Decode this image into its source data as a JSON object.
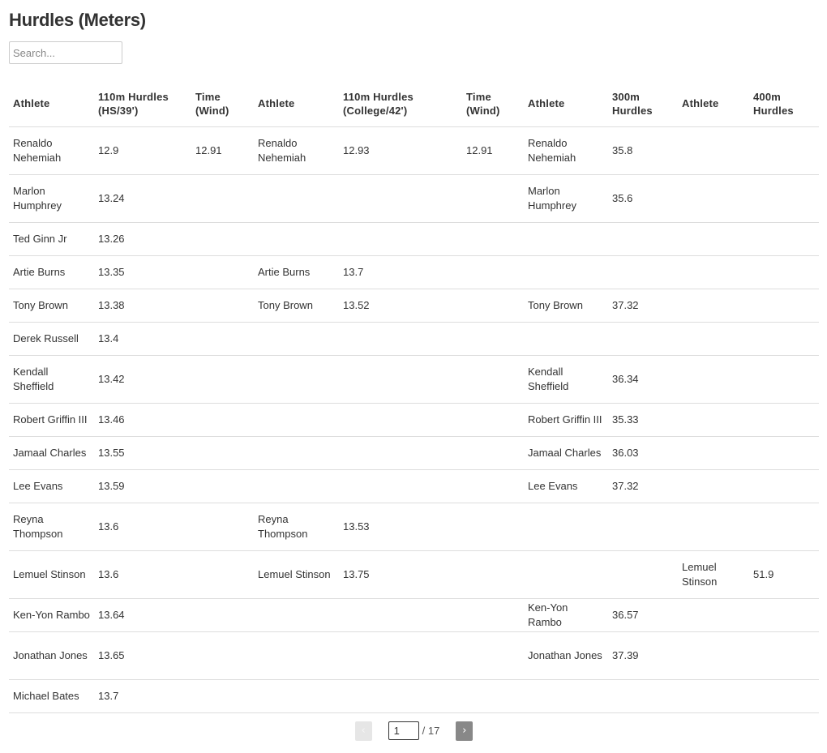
{
  "page": {
    "title": "Hurdles (Meters)"
  },
  "search": {
    "placeholder": "Search...",
    "value": ""
  },
  "table": {
    "columns": [
      {
        "line1": "Athlete",
        "line2": ""
      },
      {
        "line1": "110m Hurdles",
        "line2": "(HS/39')"
      },
      {
        "line1": "Time",
        "line2": "(Wind)"
      },
      {
        "line1": "Athlete",
        "line2": ""
      },
      {
        "line1": "110m Hurdles",
        "line2": "(College/42')"
      },
      {
        "line1": "Time",
        "line2": "(Wind)"
      },
      {
        "line1": "Athlete",
        "line2": ""
      },
      {
        "line1": "300m",
        "line2": "Hurdles"
      },
      {
        "line1": "Athlete",
        "line2": ""
      },
      {
        "line1": "400m",
        "line2": "Hurdles"
      }
    ],
    "rows": [
      [
        "Renaldo Nehemiah",
        "12.9",
        "12.91",
        "Renaldo Nehemiah",
        "12.93",
        "12.91",
        "Renaldo Nehemiah",
        "35.8",
        "",
        ""
      ],
      [
        "Marlon Humphrey",
        "13.24",
        "",
        "",
        "",
        "",
        "Marlon Humphrey",
        "35.6",
        "",
        ""
      ],
      [
        "Ted Ginn Jr",
        "13.26",
        "",
        "",
        "",
        "",
        "",
        "",
        "",
        ""
      ],
      [
        "Artie Burns",
        "13.35",
        "",
        "Artie Burns",
        "13.7",
        "",
        "",
        "",
        "",
        ""
      ],
      [
        "Tony Brown",
        "13.38",
        "",
        "Tony Brown",
        "13.52",
        "",
        "Tony Brown",
        "37.32",
        "",
        ""
      ],
      [
        "Derek Russell",
        "13.4",
        "",
        "",
        "",
        "",
        "",
        "",
        "",
        ""
      ],
      [
        "Kendall Sheffield",
        "13.42",
        "",
        "",
        "",
        "",
        "Kendall Sheffield",
        "36.34",
        "",
        ""
      ],
      [
        "Robert Griffin III",
        "13.46",
        "",
        "",
        "",
        "",
        "Robert Griffin III",
        "35.33",
        "",
        ""
      ],
      [
        "Jamaal Charles",
        "13.55",
        "",
        "",
        "",
        "",
        "Jamaal Charles",
        "36.03",
        "",
        ""
      ],
      [
        "Lee Evans",
        "13.59",
        "",
        "",
        "",
        "",
        "Lee Evans",
        "37.32",
        "",
        ""
      ],
      [
        "Reyna Thompson",
        "13.6",
        "",
        "Reyna Thompson",
        "13.53",
        "",
        "",
        "",
        "",
        ""
      ],
      [
        "Lemuel Stinson",
        "13.6",
        "",
        "Lemuel Stinson",
        "13.75",
        "",
        "",
        "",
        "Lemuel Stinson",
        "51.9"
      ],
      [
        "Ken-Yon Rambo",
        "13.64",
        "",
        "",
        "",
        "",
        "Ken-Yon Rambo",
        "36.57",
        "",
        ""
      ],
      [
        "Jonathan Jones",
        "13.65",
        "",
        "",
        "",
        "",
        "Jonathan Jones",
        "37.39",
        "",
        ""
      ],
      [
        "Michael Bates",
        "13.7",
        "",
        "",
        "",
        "",
        "",
        "",
        "",
        ""
      ]
    ]
  },
  "pagination": {
    "prev_label": "‹",
    "next_label": "›",
    "current_page": "1",
    "total_label": "/ 17",
    "prev_icon": "chevron-left-icon",
    "next_icon": "chevron-right-icon"
  },
  "colors": {
    "text": "#333333",
    "border": "#dddddd",
    "next_button": "#888888",
    "prev_button_disabled": "#e6e6e6"
  }
}
